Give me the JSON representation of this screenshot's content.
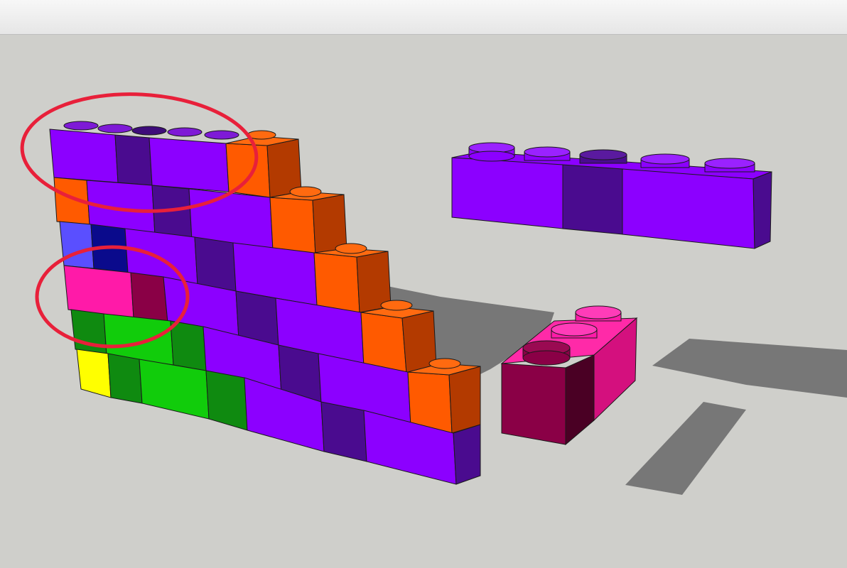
{
  "window": {
    "title": ""
  },
  "scene": {
    "background": "#cfcfcb",
    "ground_shadow_color": "#777777",
    "annotation_color": "#e8203a",
    "palette": {
      "purple": "#8c00ff",
      "dark_purple": "#4a0b8f",
      "orange": "#ff5a00",
      "orange_side": "#b33a00",
      "blue": "#5a4fff",
      "navy": "#0a0a8c",
      "magenta": "#ff1aa8",
      "maroon": "#8a0046",
      "dark_green": "#0f8a10",
      "green": "#11cc0b",
      "yellow": "#ffff00"
    },
    "objects": [
      "brick-wall",
      "purple-1x5-brick",
      "magenta-1x3-brick",
      "annotation-ellipse-top",
      "annotation-ellipse-middle"
    ]
  }
}
